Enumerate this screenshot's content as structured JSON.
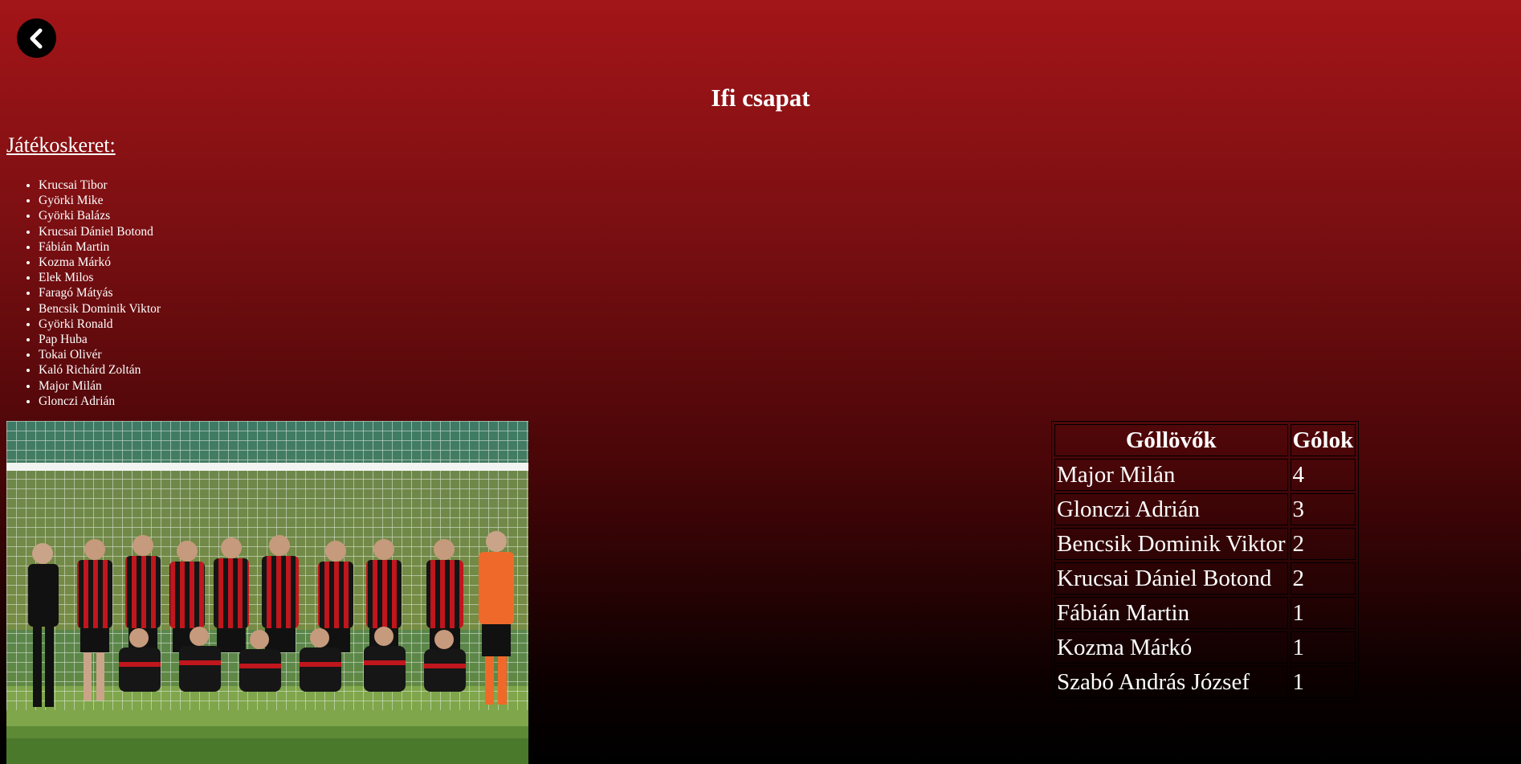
{
  "page": {
    "title": "Ifi csapat",
    "back_icon": "chevron-left-icon"
  },
  "roster": {
    "heading": "Játékoskeret:",
    "players": [
      "Krucsai Tibor",
      "Györki Mike",
      "Györki Balázs",
      "Krucsai Dániel Botond",
      "Fábián Martin",
      "Kozma Márkó",
      "Elek Milos",
      "Faragó Mátyás",
      "Bencsik Dominik Viktor",
      "Györki Ronald",
      "Pap Huba",
      "Tokai Olivér",
      "Kaló Richárd Zoltán",
      "Major Milán",
      "Glonczi Adrián"
    ]
  },
  "scorers": {
    "headers": [
      "Góllövők",
      "Gólok"
    ],
    "rows": [
      {
        "name": "Major Milán",
        "goals": "4"
      },
      {
        "name": "Glonczi Adrián",
        "goals": "3"
      },
      {
        "name": "Bencsik Dominik Viktor",
        "goals": "2"
      },
      {
        "name": "Krucsai Dániel Botond",
        "goals": "2"
      },
      {
        "name": "Fábián Martin",
        "goals": "1"
      },
      {
        "name": "Kozma Márkó",
        "goals": "1"
      },
      {
        "name": "Szabó András József",
        "goals": "1"
      }
    ]
  },
  "colors": {
    "background_top": "#a31518",
    "background_bottom": "#000000",
    "text": "#ffffff",
    "jersey_red": "#c0161d",
    "jersey_black": "#141414"
  }
}
